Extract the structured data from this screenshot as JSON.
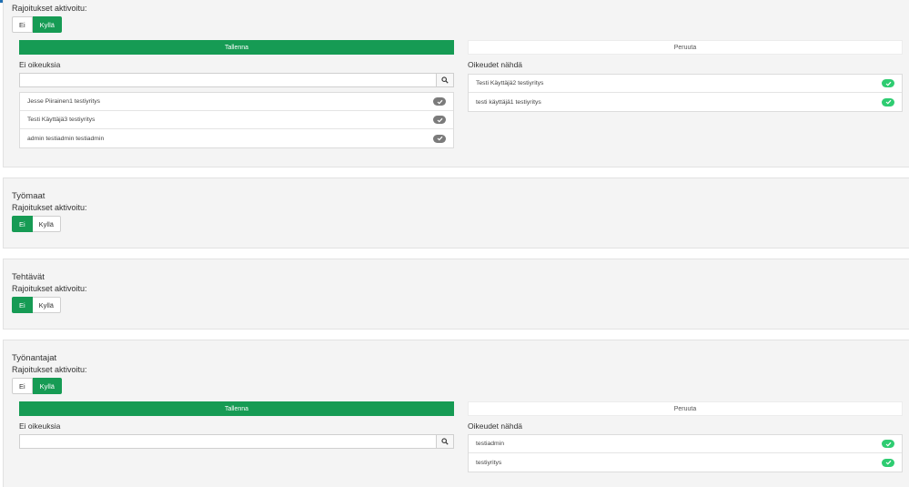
{
  "colors": {
    "accent": "#169b54",
    "toggle_gray": "#7b7b7b",
    "toggle_green": "#2ecc71",
    "panel_bg": "#f4f4f4",
    "top_bar": "#1f6fb2"
  },
  "sections": [
    {
      "restrictions_label": "Rajoitukset aktivoitu:",
      "toggle": {
        "no": "Ei",
        "yes": "Kyllä",
        "selected": "Kyllä"
      },
      "save_label": "Tallenna",
      "cancel_label": "Peruuta",
      "no_rights_title": "Ei oikeuksia",
      "search_value": "",
      "search_icon": "search-icon",
      "no_rights_items": [
        {
          "label": "Jesse Piirainen1 testiyritys",
          "enabled": false
        },
        {
          "label": "Testi Käyttäjä3 testiyritys",
          "enabled": false
        },
        {
          "label": "admin testiadmin testiadmin",
          "enabled": false
        }
      ],
      "rights_title": "Oikeudet nähdä",
      "rights_items": [
        {
          "label": "Testi Käyttäjä2 testiyritys",
          "enabled": true
        },
        {
          "label": "testi käyttäjä1 testiyritys",
          "enabled": true
        }
      ]
    },
    {
      "title": "Työmaat",
      "restrictions_label": "Rajoitukset aktivoitu:",
      "toggle": {
        "no": "Ei",
        "yes": "Kyllä",
        "selected": "Ei"
      }
    },
    {
      "title": "Tehtävät",
      "restrictions_label": "Rajoitukset aktivoitu:",
      "toggle": {
        "no": "Ei",
        "yes": "Kyllä",
        "selected": "Ei"
      }
    },
    {
      "title": "Työnantajat",
      "restrictions_label": "Rajoitukset aktivoitu:",
      "toggle": {
        "no": "Ei",
        "yes": "Kyllä",
        "selected": "Kyllä"
      },
      "save_label": "Tallenna",
      "cancel_label": "Peruuta",
      "no_rights_title": "Ei oikeuksia",
      "search_value": "",
      "search_icon": "search-icon",
      "rights_title": "Oikeudet nähdä",
      "rights_items": [
        {
          "label": "testiadmin",
          "enabled": true
        },
        {
          "label": "testiyritys",
          "enabled": true
        }
      ]
    }
  ]
}
